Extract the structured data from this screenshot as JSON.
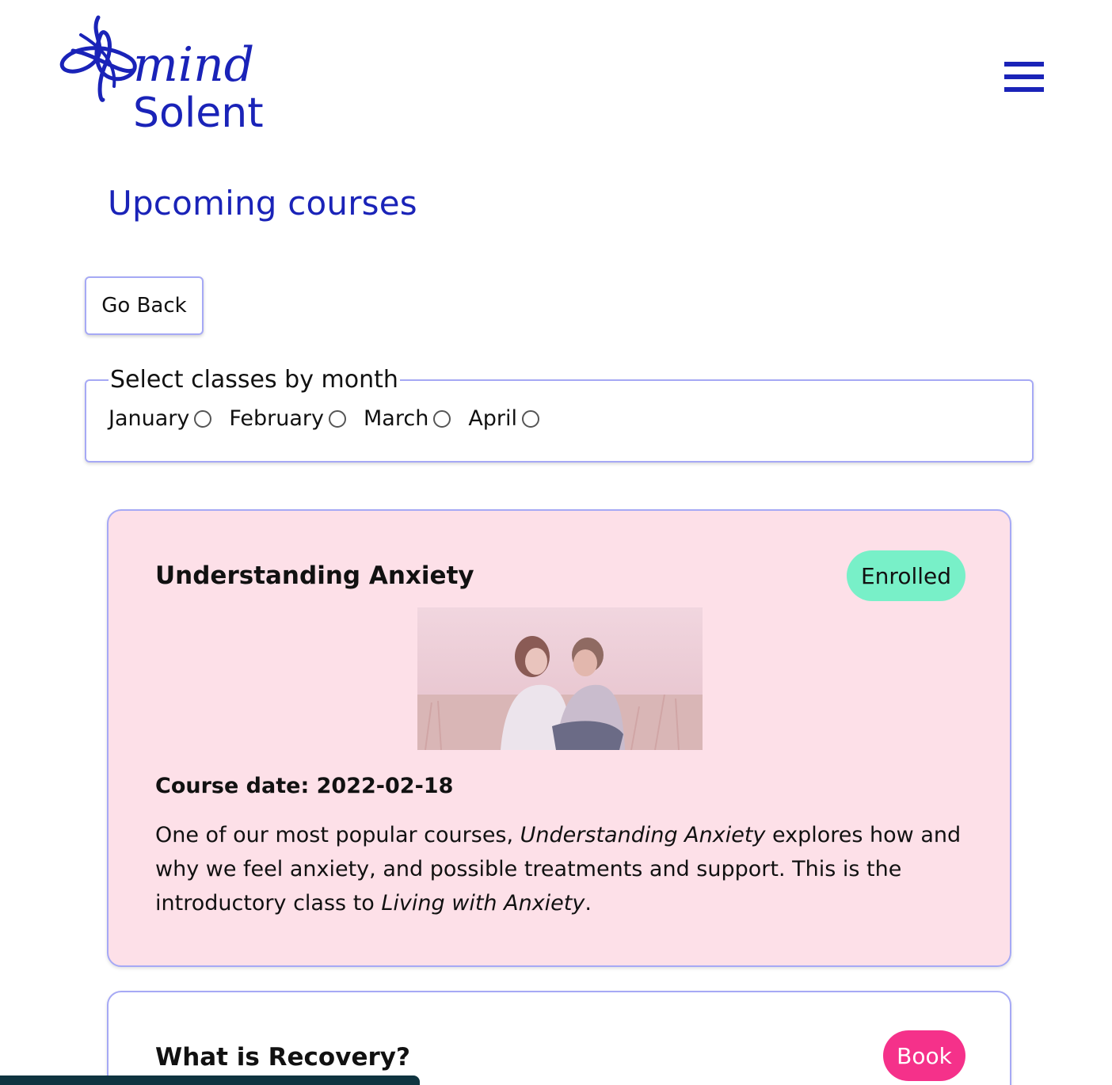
{
  "brand": {
    "logo_word": "mind",
    "logo_sub": "Solent",
    "color": "#1a23b8"
  },
  "header": {
    "menu_icon": "hamburger-icon"
  },
  "page": {
    "title": "Upcoming courses"
  },
  "actions": {
    "go_back_label": "Go Back"
  },
  "filter": {
    "legend": "Select classes by month",
    "months": [
      "January",
      "February",
      "March",
      "April"
    ]
  },
  "courses": [
    {
      "title": "Understanding Anxiety",
      "status": "Enrolled",
      "status_color": "#78f0c8",
      "card_color": "#fde0e8",
      "date_label": "Course date: 2022-02-18",
      "desc_part1": "One of our most popular courses, ",
      "desc_em1": "Understanding Anxiety",
      "desc_part2": " explores how and why we feel anxiety, and possible treatments and support. This is the introductory class to ",
      "desc_em2": "Living with Anxiety",
      "desc_part3": "."
    },
    {
      "title": "What is Recovery?",
      "status": "Book",
      "status_color": "#f5318a"
    }
  ]
}
